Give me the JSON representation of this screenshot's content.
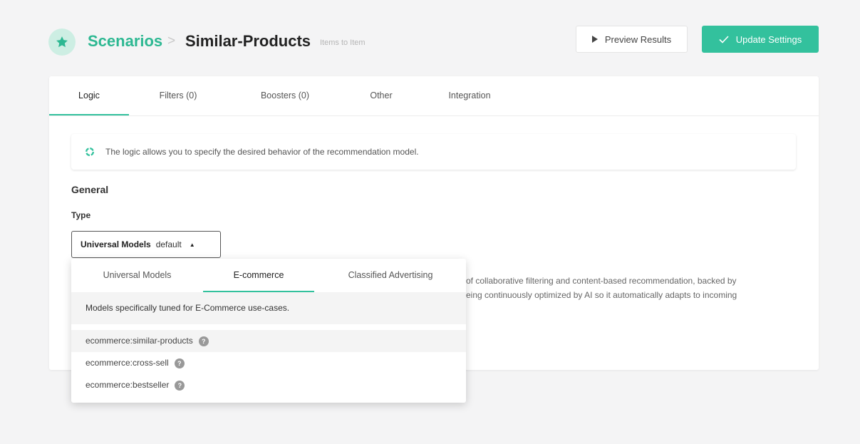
{
  "header": {
    "breadcrumb_root": "Scenarios",
    "breadcrumb_separator": ">",
    "title": "Similar-Products",
    "subtitle": "Items to Item",
    "preview_label": "Preview Results",
    "update_label": "Update Settings"
  },
  "tabs": [
    {
      "label": "Logic",
      "active": true
    },
    {
      "label": "Filters (0)",
      "active": false
    },
    {
      "label": "Boosters (0)",
      "active": false
    },
    {
      "label": "Other",
      "active": false
    },
    {
      "label": "Integration",
      "active": false
    }
  ],
  "info": {
    "text": "The logic allows you to specify the desired behavior of the recommendation model."
  },
  "general": {
    "title": "General",
    "type_label": "Type",
    "type_value": "Universal Models",
    "type_tag": "default"
  },
  "description": {
    "line1": "of collaborative filtering and content-based recommendation, backed by",
    "line2": "eing continuously optimized by AI so it automatically adapts to incoming"
  },
  "dropdown": {
    "tabs": [
      {
        "label": "Universal Models",
        "active": false
      },
      {
        "label": "E-commerce",
        "active": true
      },
      {
        "label": "Classified Advertising",
        "active": false
      }
    ],
    "description": "Models specifically tuned for E-Commerce use-cases.",
    "items": [
      {
        "label": "ecommerce:similar-products",
        "selected": true
      },
      {
        "label": "ecommerce:cross-sell",
        "selected": false
      },
      {
        "label": "ecommerce:bestseller",
        "selected": false
      }
    ]
  },
  "colors": {
    "accent": "#33c19d",
    "accent_text": "#2db892",
    "badge_bg": "#cdeee3"
  },
  "icons": {
    "header_badge": "star-icon",
    "preview": "play-icon",
    "update": "check-icon",
    "info": "loader-ring-icon",
    "item_help": "question-mark-icon"
  }
}
